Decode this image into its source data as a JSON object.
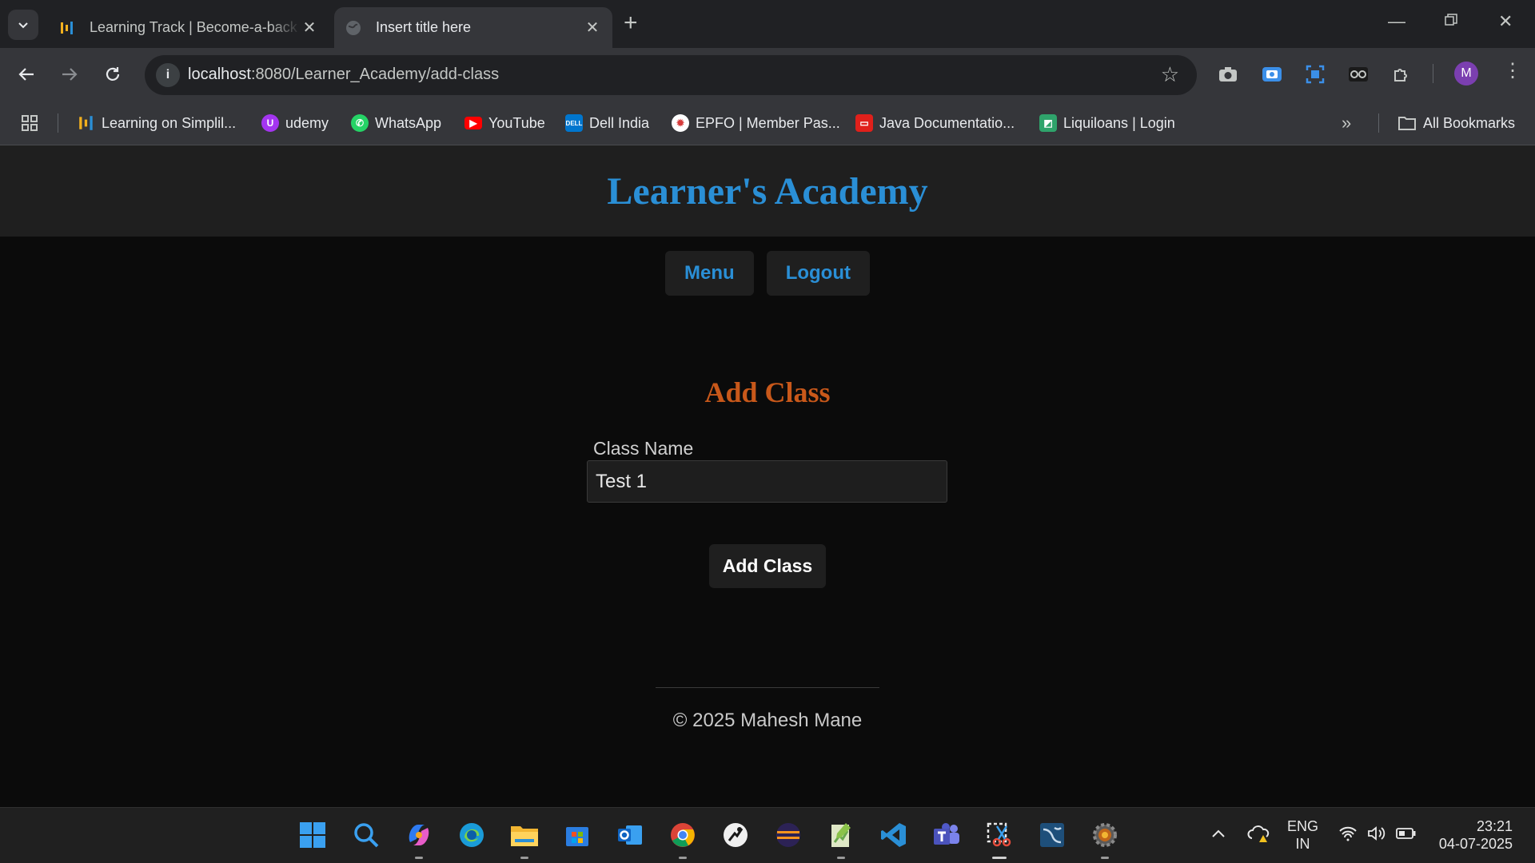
{
  "browser": {
    "tabs": [
      {
        "title": "Learning Track | Become-a-back",
        "active": false
      },
      {
        "title": "Insert title here",
        "active": true
      }
    ],
    "new_tab_icon": "plus-icon",
    "address": {
      "host": "localhost",
      "path": ":8080/Learner_Academy/add-class"
    },
    "bookmarks": [
      {
        "label": "Learning on Simplil...",
        "icon": "simplilearn-icon",
        "color": "#f2b01e"
      },
      {
        "label": "udemy",
        "icon": "udemy-icon",
        "color": "#a435f0"
      },
      {
        "label": "WhatsApp",
        "icon": "whatsapp-icon",
        "color": "#25d366"
      },
      {
        "label": "YouTube",
        "icon": "youtube-icon",
        "color": "#ff0000"
      },
      {
        "label": "Dell India",
        "icon": "dell-icon",
        "color": "#0076ce"
      },
      {
        "label": "EPFO | Member Pas...",
        "icon": "epfo-icon",
        "color": "#d63b3b"
      },
      {
        "label": "Java Documentatio...",
        "icon": "oracle-icon",
        "color": "#e0201b"
      },
      {
        "label": "Liquiloans | Login",
        "icon": "liquiloans-icon",
        "color": "#2fa36b"
      }
    ],
    "all_bookmarks": "All Bookmarks",
    "avatar_letter": "M"
  },
  "page": {
    "site_title": "Learner's Academy",
    "nav": {
      "menu": "Menu",
      "logout": "Logout"
    },
    "form": {
      "title": "Add Class",
      "class_name_label": "Class Name",
      "class_name_value": "Test 1",
      "submit_label": "Add Class"
    },
    "footer": "© 2025 Mahesh Mane"
  },
  "colors": {
    "accent_blue": "#2a8fd6",
    "form_title_orange": "#c8581a"
  },
  "taskbar": {
    "lang": "ENG",
    "region": "IN",
    "time": "23:21",
    "date": "04-07-2025"
  }
}
